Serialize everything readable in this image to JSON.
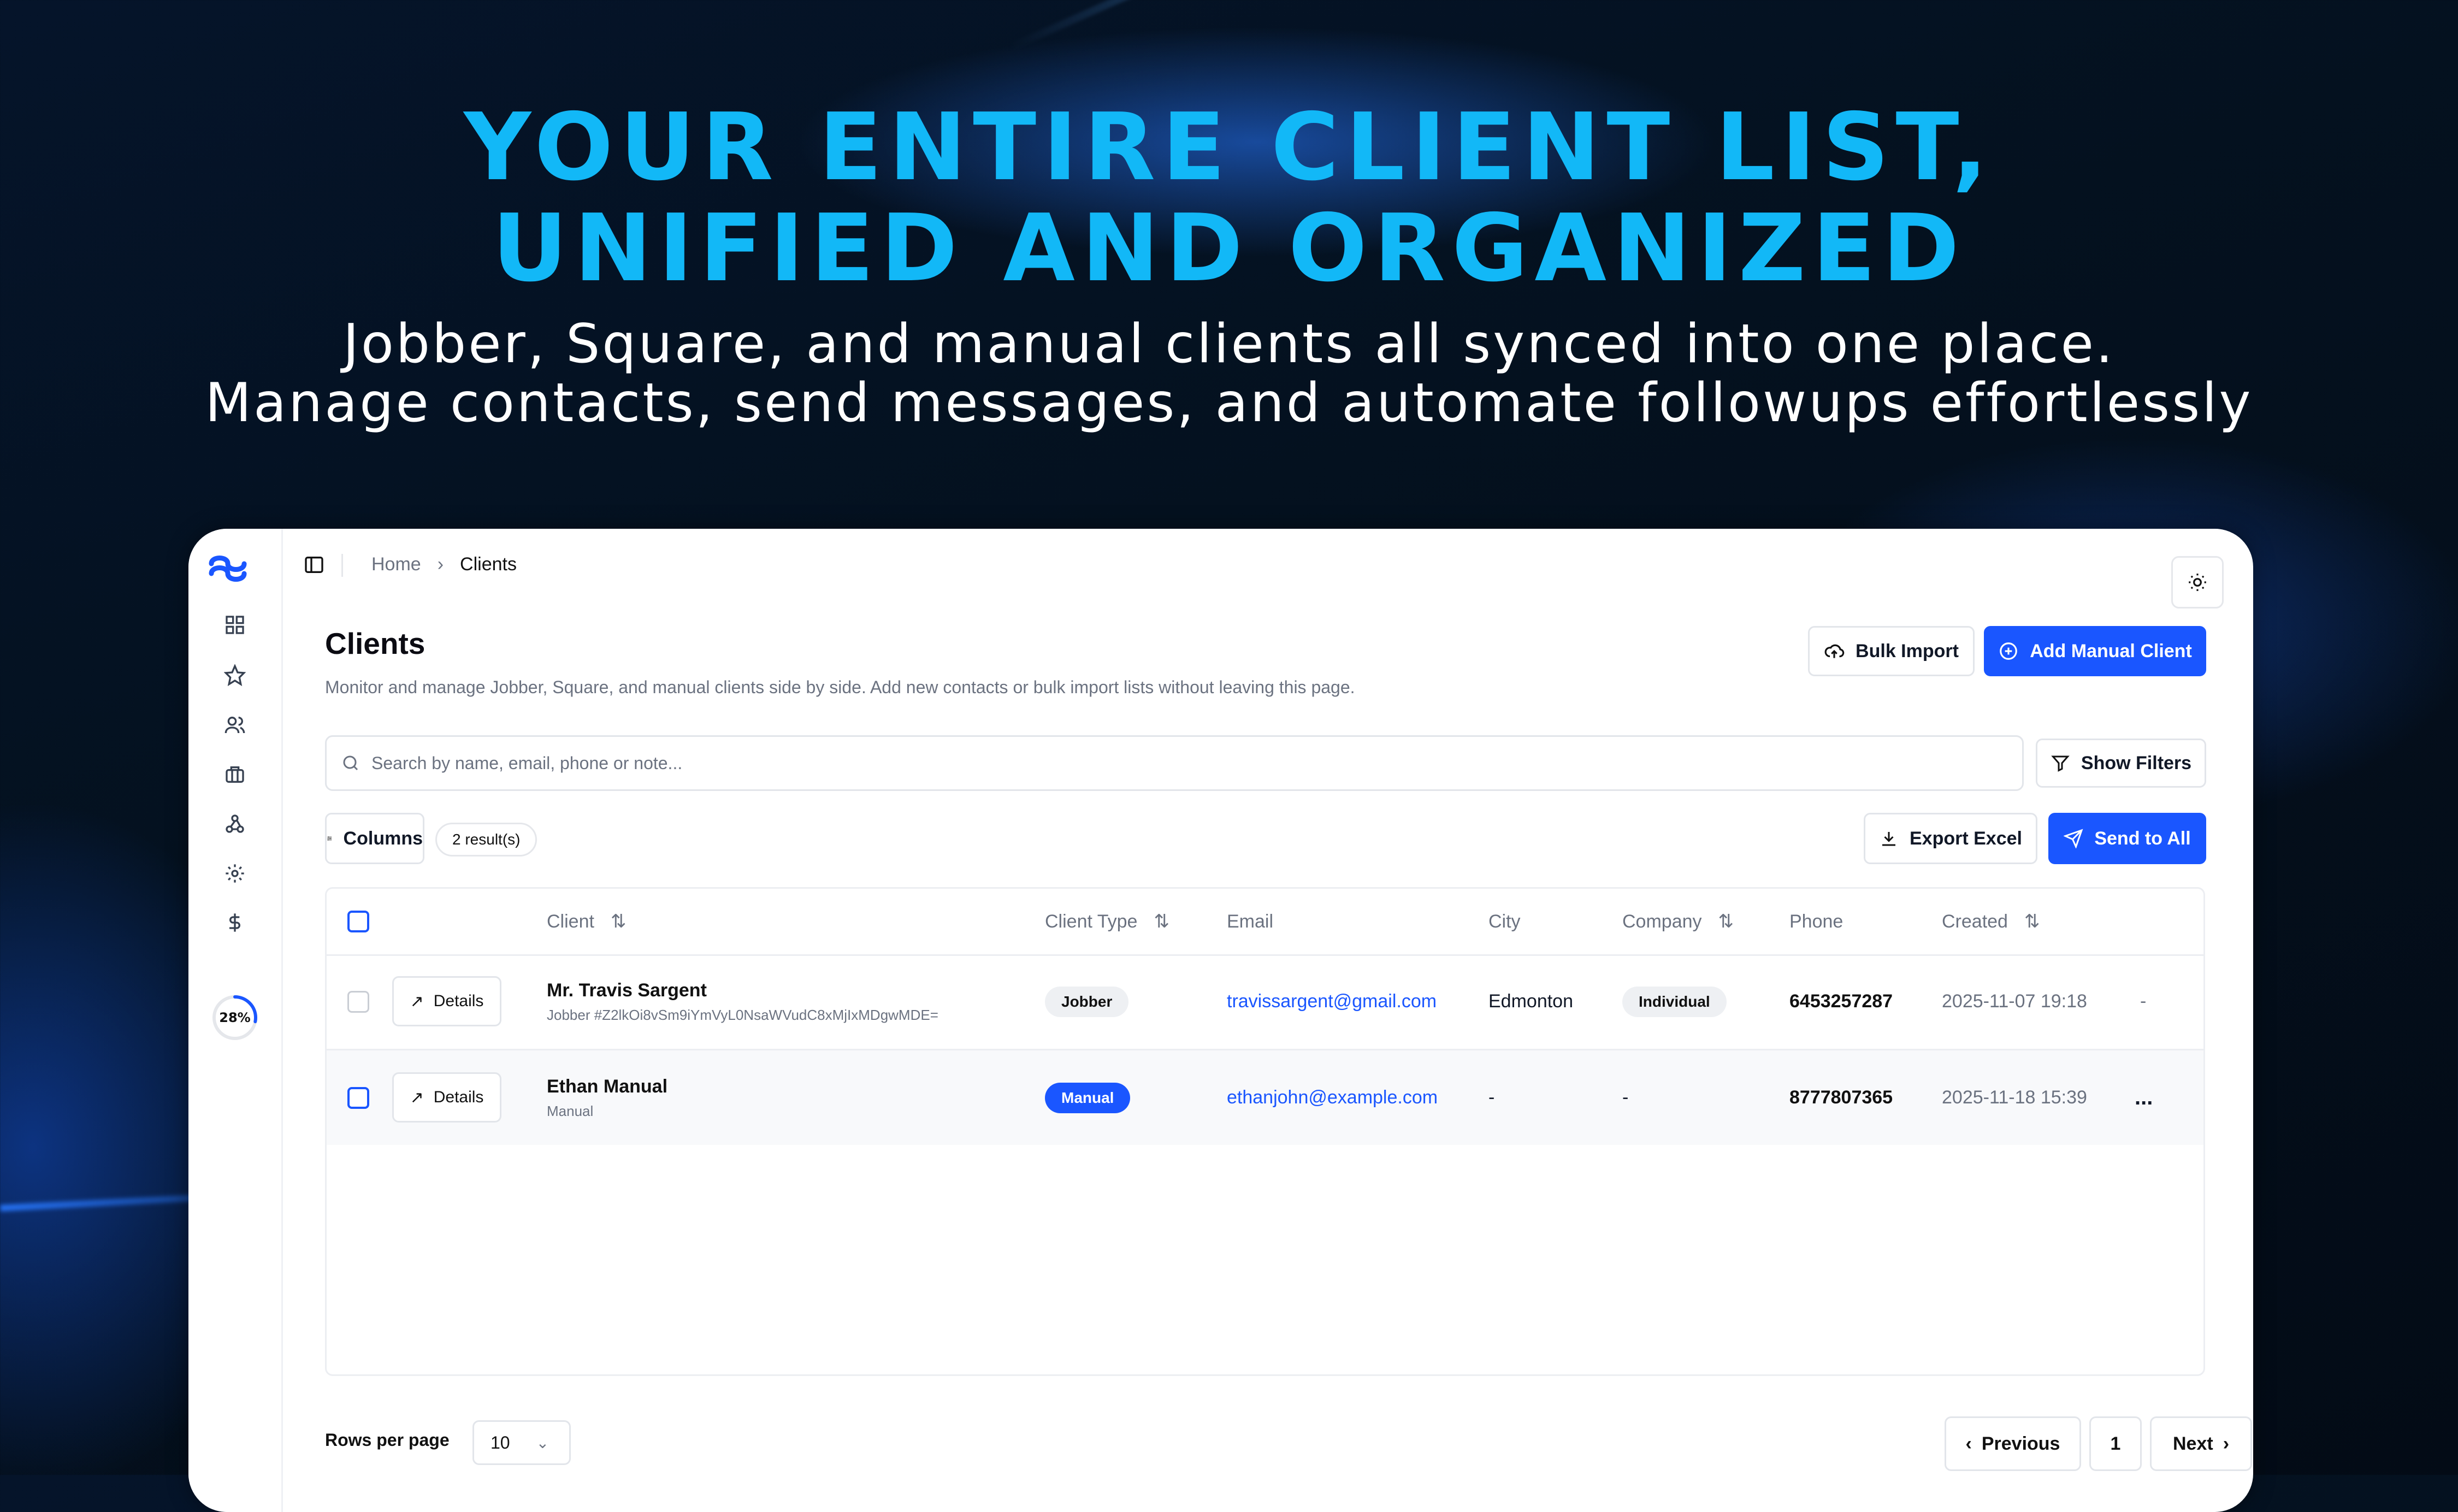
{
  "hero": {
    "headline_line1": "YOUR ENTIRE CLIENT LIST,",
    "headline_line2": "UNIFIED AND ORGANIZED",
    "sub_line1": "Jobber, Square, and manual clients all synced into one place.",
    "sub_line2": "Manage contacts, send messages, and automate followups effortlessly"
  },
  "colors": {
    "accent": "#12b8f7",
    "primary": "#1a56ff"
  },
  "sidebar": {
    "icons": [
      "logo-icon",
      "dashboard-icon",
      "star-icon",
      "users-icon",
      "briefcase-icon",
      "webhook-icon",
      "settings-icon",
      "dollar-icon"
    ],
    "progress_label": "28%",
    "progress_value": 0.28
  },
  "breadcrumb": {
    "home": "Home",
    "current": "Clients"
  },
  "page": {
    "title": "Clients",
    "description": "Monitor and manage Jobber, Square, and manual clients side by side. Add new contacts or bulk import lists without leaving this page."
  },
  "actions": {
    "bulk_import": "Bulk Import",
    "add_manual_client": "Add Manual Client",
    "show_filters": "Show Filters",
    "columns": "Columns",
    "results": "2 result(s)",
    "export_excel": "Export Excel",
    "send_to_all": "Send to All"
  },
  "search": {
    "placeholder": "Search by name, email, phone or note...",
    "value": ""
  },
  "table": {
    "headers": {
      "client": "Client",
      "client_type": "Client Type",
      "email": "Email",
      "city": "City",
      "company": "Company",
      "phone": "Phone",
      "created": "Created"
    },
    "rows": [
      {
        "details": "Details",
        "name": "Mr. Travis Sargent",
        "sub": "Jobber #Z2lkOi8vSm9iYmVyL0NsaWVudC8xMjIxMDgwMDE=",
        "type": "Jobber",
        "email": "travissargent@gmail.com",
        "city": "Edmonton",
        "company": "Individual",
        "phone": "6453257287",
        "created": "2025-11-07 19:18",
        "extra": "-"
      },
      {
        "details": "Details",
        "name": "Ethan Manual",
        "sub": "Manual",
        "type": "Manual",
        "email": "ethanjohn@example.com",
        "city": "-",
        "company": "-",
        "phone": "8777807365",
        "created": "2025-11-18 15:39",
        "extra": "..."
      }
    ]
  },
  "footer": {
    "rows_per_page_label": "Rows per page",
    "rows_per_page_value": "10",
    "previous": "Previous",
    "page": "1",
    "next": "Next"
  }
}
